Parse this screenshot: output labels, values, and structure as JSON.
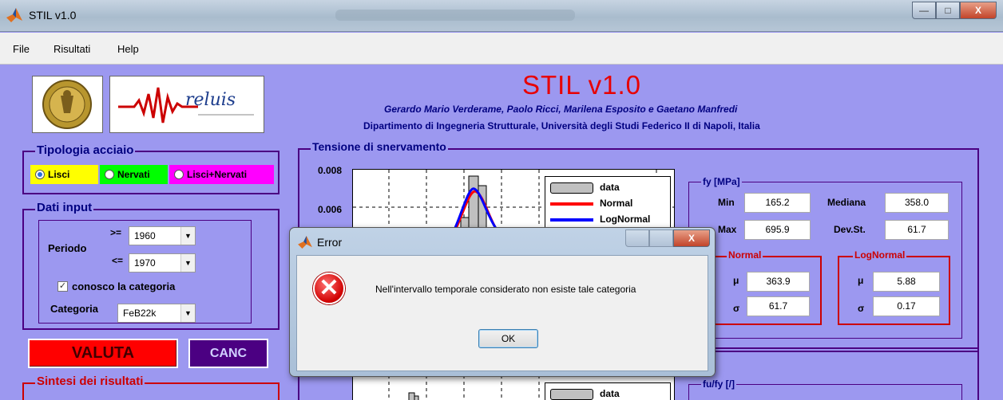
{
  "window": {
    "title": "STIL v1.0",
    "min": "—",
    "max": "□",
    "close": "X"
  },
  "menu": [
    "File",
    "Risultati",
    "Help"
  ],
  "header": {
    "title": "STIL v1.0",
    "authors": "Gerardo Mario Verderame, Paolo Ricci, Marilena Esposito e Gaetano Manfredi",
    "department": "Dipartimento di Ingegneria Strutturale, Università degli Studi Federico II di Napoli, Italia",
    "reluis_logo": "reluis"
  },
  "tipologia": {
    "title": "Tipologia acciaio",
    "options": [
      {
        "label": "Lisci",
        "selected": true,
        "color": "#ffff00"
      },
      {
        "label": "Nervati",
        "selected": false,
        "color": "#00ff00"
      },
      {
        "label": "Lisci+Nervati",
        "selected": false,
        "color": "#ff00ff"
      }
    ]
  },
  "dati": {
    "title": "Dati input",
    "periodo_label": "Periodo",
    "ge": ">=",
    "le": "<=",
    "from": "1960",
    "to": "1970",
    "conosco_label": "conosco la categoria",
    "conosco_checked": true,
    "categoria_label": "Categoria",
    "categoria": "FeB22k"
  },
  "buttons": {
    "valuta": "VALUTA",
    "canc": "CANC"
  },
  "sintesi": {
    "title": "Sintesi dei risultati"
  },
  "tensione": {
    "title": "Tensione di snervamento",
    "y_ticks": [
      "0.008",
      "0.006"
    ],
    "legend": [
      "data",
      "Normal",
      "LogNormal"
    ]
  },
  "fy": {
    "title": "fy [MPa]",
    "min_label": "Min",
    "min": "165.2",
    "max_label": "Max",
    "max": "695.9",
    "mediana_label": "Mediana",
    "mediana": "358.0",
    "devst_label": "Dev.St.",
    "devst": "61.7",
    "normal": {
      "title": "Normal",
      "mu_label": "μ",
      "mu": "363.9",
      "sigma_label": "σ",
      "sigma": "61.7"
    },
    "lognormal": {
      "title": "LogNormal",
      "mu_label": "μ",
      "mu": "5.88",
      "sigma_label": "σ",
      "sigma": "0.17"
    }
  },
  "second_plot": {
    "legend": [
      "data"
    ]
  },
  "fufy": {
    "title": "fu/fy [/]"
  },
  "dialog": {
    "title": "Error",
    "message": "Nell'intervallo temporale considerato non esiste tale categoria",
    "ok": "OK",
    "error_icon": "error-x-icon",
    "close": "X"
  }
}
